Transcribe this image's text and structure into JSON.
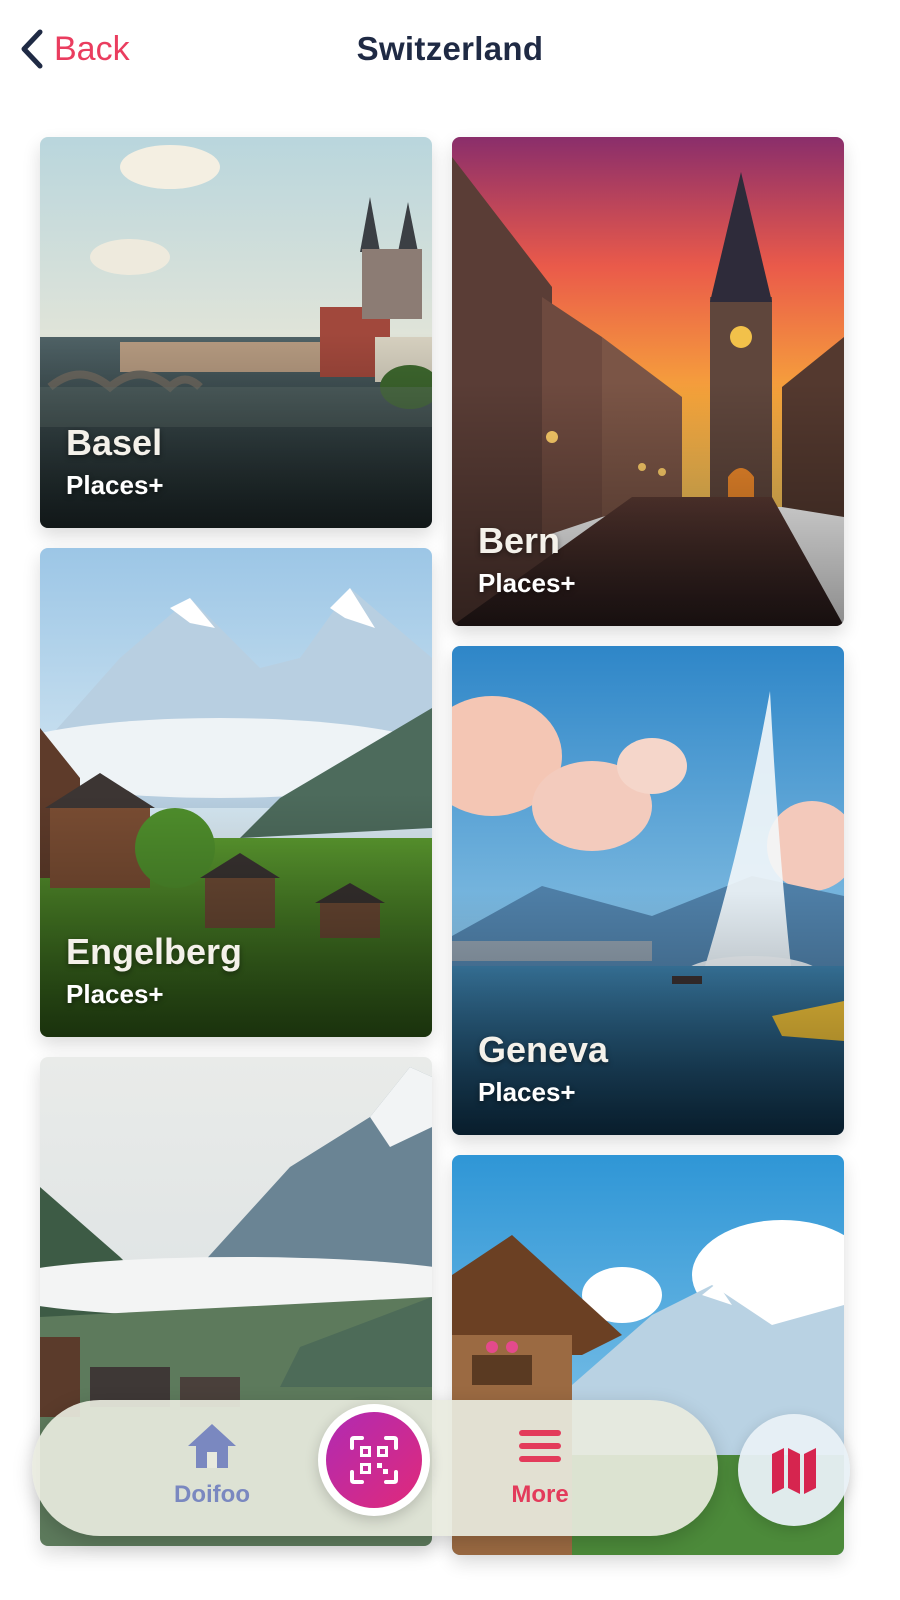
{
  "header": {
    "back_label": "Back",
    "title": "Switzerland"
  },
  "cards": [
    {
      "name": "Basel",
      "subtitle": "Places+"
    },
    {
      "name": "Bern",
      "subtitle": "Places+"
    },
    {
      "name": "Engelberg",
      "subtitle": "Places+"
    },
    {
      "name": "Geneva",
      "subtitle": "Places+"
    },
    {
      "name": "",
      "subtitle": ""
    },
    {
      "name": "",
      "subtitle": ""
    }
  ],
  "tabbar": {
    "home_label": "Doifoo",
    "more_label": "More",
    "home_icon": "home-icon",
    "scan_icon": "qr-scan-icon",
    "more_icon": "menu-icon",
    "map_icon": "map-icon"
  },
  "colors": {
    "accent": "#ea3d5f",
    "title": "#1f2a44",
    "home_tab": "#7a88c0",
    "qr_gradient_start": "#b02bb3",
    "qr_gradient_end": "#e0297a"
  }
}
